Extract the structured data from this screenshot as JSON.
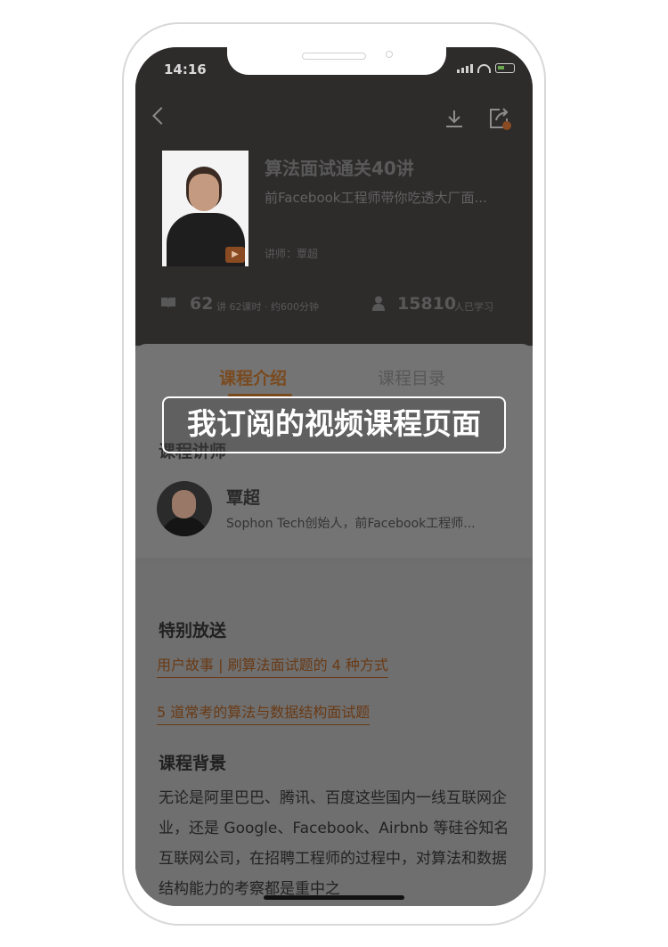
{
  "status_bar": {
    "time": "14:16"
  },
  "course": {
    "title": "算法面试通关40讲",
    "subtitle": "前Facebook工程师带你吃透大厂面...",
    "instructor_line": "讲师：覃超",
    "lesson_count": "62",
    "lesson_unit": "讲 62课时 · 约600分钟",
    "learner_count": "15810",
    "learner_unit": "人已学习"
  },
  "tabs": {
    "intro": "课程介绍",
    "catalog": "课程目录"
  },
  "teacher_section": {
    "label": "课程讲师",
    "name": "覃超",
    "bio": "Sophon Tech创始人，前Facebook工程师..."
  },
  "special": {
    "title": "特别放送",
    "links": [
      "用户故事 | 刷算法面试题的 4 种方式",
      "5 道常考的算法与数据结构面试题"
    ]
  },
  "background": {
    "title": "课程背景",
    "text": "无论是阿里巴巴、腾讯、百度这些国内一线互联网企业，还是 Google、Facebook、Airbnb 等硅谷知名互联网公司，在招聘工程师的过程中，对算法和数据结构能力的考察都是重中之"
  },
  "overlay": {
    "label": "我订阅的视频课程页面"
  },
  "colors": {
    "accent": "#7a4a1f",
    "dim_overlay": "#6e6e6e"
  }
}
